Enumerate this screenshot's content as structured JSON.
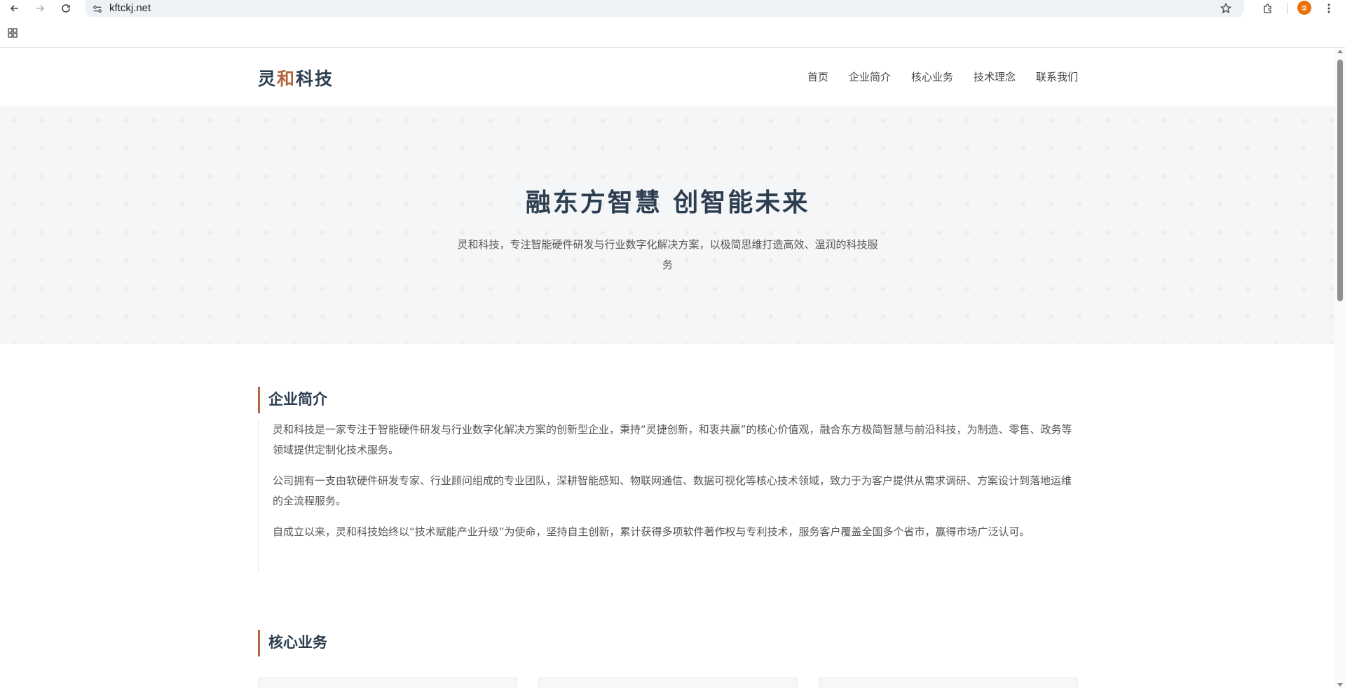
{
  "browser": {
    "url": "kftckj.net",
    "avatar_letter": "李",
    "accent_color": "#e8710a"
  },
  "site": {
    "logo": {
      "part1": "灵",
      "part2": "和",
      "part3": "科技"
    },
    "nav": [
      "首页",
      "企业简介",
      "核心业务",
      "技术理念",
      "联系我们"
    ],
    "brand_color": "#2c3e50",
    "accent_color": "#b5673f"
  },
  "hero": {
    "title": "融东方智慧 创智能未来",
    "subtitle": "灵和科技，专注智能硬件研发与行业数字化解决方案，以极简思维打造高效、温润的科技服务"
  },
  "about": {
    "title": "企业简介",
    "paragraphs": [
      "灵和科技是一家专注于智能硬件研发与行业数字化解决方案的创新型企业，秉持“灵捷创新，和衷共赢”的核心价值观，融合东方极简智慧与前沿科技，为制造、零售、政务等领域提供定制化技术服务。",
      "公司拥有一支由软硬件研发专家、行业顾问组成的专业团队，深耕智能感知、物联网通信、数据可视化等核心技术领域，致力于为客户提供从需求调研、方案设计到落地运维的全流程服务。",
      "自成立以来，灵和科技始终以“技术赋能产业升级”为使命，坚持自主创新，累计获得多项软件著作权与专利技术，服务客户覆盖全国多个省市，赢得市场广泛认可。"
    ]
  },
  "business": {
    "title": "核心业务"
  }
}
